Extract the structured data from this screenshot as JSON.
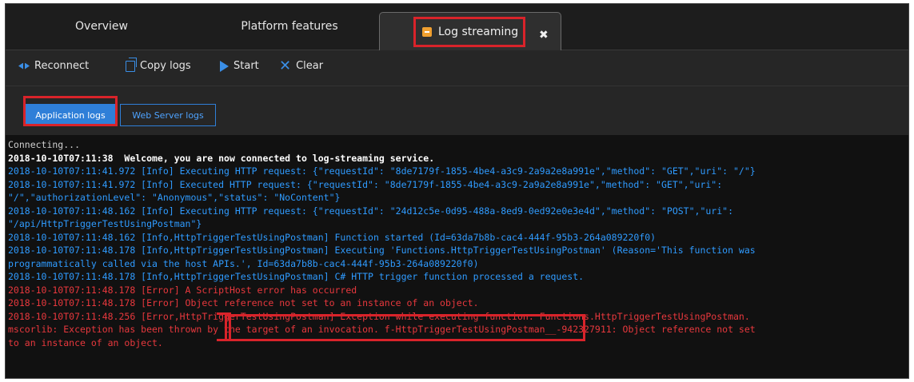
{
  "tabs": {
    "overview": "Overview",
    "platform": "Platform features",
    "log_streaming": "Log streaming",
    "close_glyph": "✖"
  },
  "toolbar": {
    "reconnect": "Reconnect",
    "copy_logs": "Copy logs",
    "start": "Start",
    "clear": "Clear"
  },
  "log_types": {
    "application": "Application logs",
    "web_server": "Web Server logs"
  },
  "log_lines": [
    {
      "color": "gray",
      "text": "Connecting..."
    },
    {
      "color": "white",
      "text": "2018-10-10T07:11:38  Welcome, you are now connected to log-streaming service."
    },
    {
      "color": "blue",
      "text": "2018-10-10T07:11:41.972 [Info] Executing HTTP request: {\"requestId\": \"8de7179f-1855-4be4-a3c9-2a9a2e8a991e\",\"method\": \"GET\",\"uri\": \"/\"}"
    },
    {
      "color": "blue",
      "text": "2018-10-10T07:11:41.972 [Info] Executed HTTP request: {\"requestId\": \"8de7179f-1855-4be4-a3c9-2a9a2e8a991e\",\"method\": \"GET\",\"uri\":"
    },
    {
      "color": "blue",
      "text": "\"/\",\"authorizationLevel\": \"Anonymous\",\"status\": \"NoContent\"}"
    },
    {
      "color": "blue",
      "text": "2018-10-10T07:11:48.162 [Info] Executing HTTP request: {\"requestId\": \"24d12c5e-0d95-488a-8ed9-0ed92e0e3e4d\",\"method\": \"POST\",\"uri\":"
    },
    {
      "color": "blue",
      "text": "\"/api/HttpTriggerTestUsingPostman\"}"
    },
    {
      "color": "blue",
      "text": "2018-10-10T07:11:48.162 [Info,HttpTriggerTestUsingPostman] Function started (Id=63da7b8b-cac4-444f-95b3-264a089220f0)"
    },
    {
      "color": "blue",
      "text": "2018-10-10T07:11:48.178 [Info,HttpTriggerTestUsingPostman] Executing 'Functions.HttpTriggerTestUsingPostman' (Reason='This function was"
    },
    {
      "color": "blue",
      "text": "programmatically called via the host APIs.', Id=63da7b8b-cac4-444f-95b3-264a089220f0)"
    },
    {
      "color": "blue",
      "text": "2018-10-10T07:11:48.178 [Info,HttpTriggerTestUsingPostman] C# HTTP trigger function processed a request."
    },
    {
      "color": "red",
      "text": "2018-10-10T07:11:48.178 [Error] A ScriptHost error has occurred"
    },
    {
      "color": "red",
      "text": "2018-10-10T07:11:48.178 [Error] Object reference not set to an instance of an object."
    },
    {
      "color": "red",
      "text": "2018-10-10T07:11:48.256 [Error,HttpTriggerTestUsingPostman] Exception while executing function: Functions.HttpTriggerTestUsingPostman."
    },
    {
      "color": "red",
      "text": "mscorlib: Exception has been thrown by the target of an invocation. f-HttpTriggerTestUsingPostman__-942327911: Object reference not set"
    },
    {
      "color": "red",
      "text": "to an instance of an object."
    }
  ],
  "colors": {
    "accent": "#2f7fd8",
    "highlight": "#d9232a",
    "info": "#2f9bff",
    "error": "#e8383d"
  }
}
